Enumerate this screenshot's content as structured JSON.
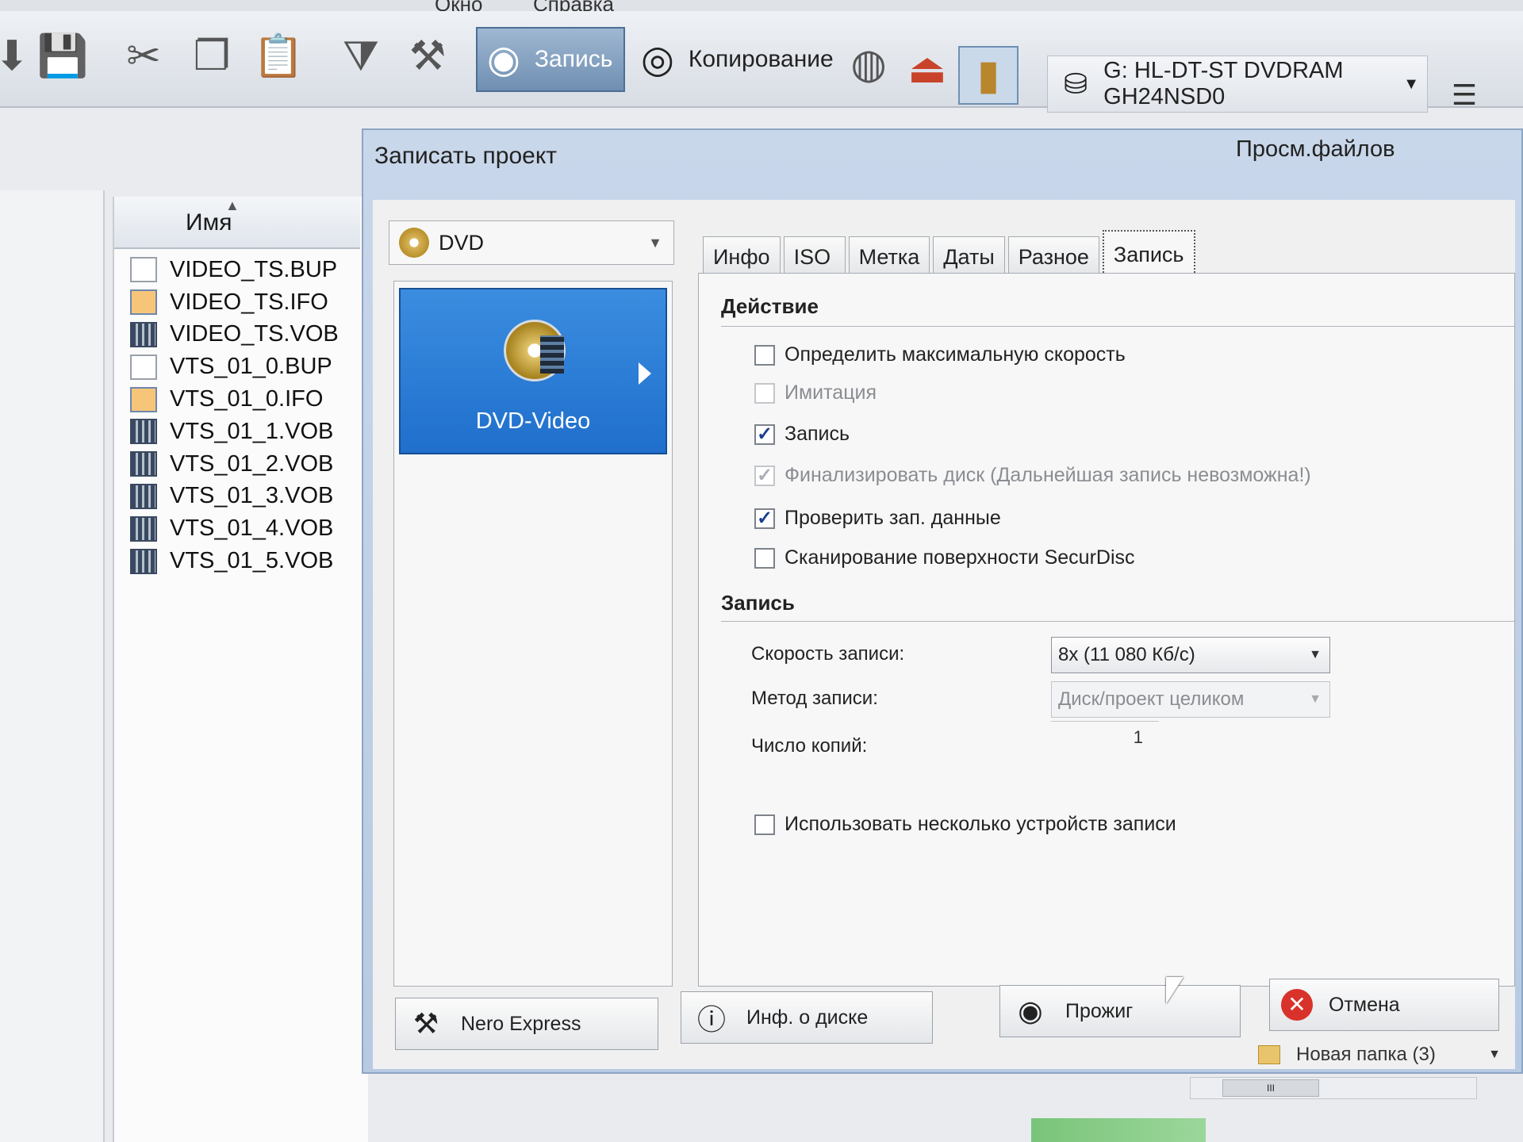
{
  "menu": {
    "items": [
      "Окно",
      "Справка"
    ]
  },
  "toolbar": {
    "icons": [
      "arrow-icon",
      "save-icon",
      "cut-icon",
      "copy-icon",
      "paste-icon",
      "filter-icon",
      "wizard-icon"
    ],
    "burn_label": "Запись",
    "copy_label": "Копирование",
    "drive_label": "G: HL-DT-ST DVDRAM GH24NSD0"
  },
  "browser": {
    "title": "Просм.файлов",
    "column_name": "Имя",
    "files": [
      {
        "name": "VIDEO_TS.BUP",
        "type": "doc"
      },
      {
        "name": "VIDEO_TS.IFO",
        "type": "ifo"
      },
      {
        "name": "VIDEO_TS.VOB",
        "type": "vob"
      },
      {
        "name": "VTS_01_0.BUP",
        "type": "doc"
      },
      {
        "name": "VTS_01_0.IFO",
        "type": "ifo"
      },
      {
        "name": "VTS_01_1.VOB",
        "type": "vob"
      },
      {
        "name": "VTS_01_2.VOB",
        "type": "vob"
      },
      {
        "name": "VTS_01_3.VOB",
        "type": "vob"
      },
      {
        "name": "VTS_01_4.VOB",
        "type": "vob"
      },
      {
        "name": "VTS_01_5.VOB",
        "type": "vob"
      }
    ],
    "folder": "Новая папка (3)"
  },
  "dialog": {
    "title": "Записать проект",
    "disc_type": "DVD",
    "project": "DVD-Video",
    "tabs": [
      "Инфо",
      "ISO",
      "Метка",
      "Даты",
      "Разное",
      "Запись"
    ],
    "selected_tab": "Запись",
    "action_section": "Действие",
    "options": [
      {
        "label": "Определить максимальную скорость",
        "checked": false,
        "disabled": false
      },
      {
        "label": "Имитация",
        "checked": false,
        "disabled": true
      },
      {
        "label": "Запись",
        "checked": true,
        "disabled": false
      },
      {
        "label": "Финализировать диск (Дальнейшая запись невозможна!)",
        "checked": true,
        "disabled": true
      },
      {
        "label": "Проверить зап. данные",
        "checked": true,
        "disabled": false
      },
      {
        "label": "Сканирование поверхности SecurDisc",
        "checked": false,
        "disabled": false
      }
    ],
    "burn_section": "Запись",
    "speed_label": "Скорость записи:",
    "speed_value": "8x (11 080 Кб/с)",
    "method_label": "Метод записи:",
    "method_value": "Диск/проект целиком",
    "copies_label": "Число копий:",
    "copies_value": "1",
    "multi_device_label": "Использовать несколько устройств записи",
    "multi_device_checked": false,
    "buttons": {
      "nero_express": "Nero Express",
      "disc_info": "Инф. о диске",
      "burn": "Прожиг",
      "cancel": "Отмена"
    }
  }
}
